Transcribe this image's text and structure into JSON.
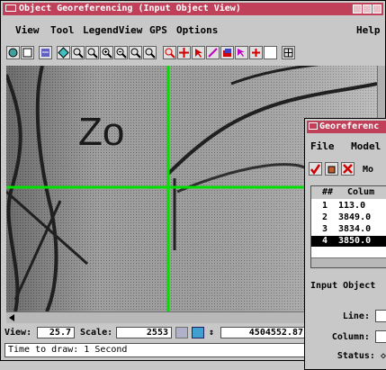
{
  "main_window": {
    "title": "Object Georeferencing (Input Object View)",
    "menu": [
      "View",
      "Tool",
      "LegendView",
      "GPS",
      "Options",
      "Help"
    ]
  },
  "map": {
    "overlay_text": "Zo",
    "crosshair_color": "#00e000"
  },
  "status": {
    "view_label": "View:",
    "view_value": "25.7",
    "scale_label": "Scale:",
    "scale_value": "2553",
    "coord_value": "4504552.87",
    "time_text": "Time to draw: 1 Second"
  },
  "georef_window": {
    "title": "Georeferenc",
    "menu": [
      "File",
      "Model"
    ],
    "toolbar_label": "Mo",
    "table": {
      "headers": [
        "##",
        "Colum"
      ],
      "rows": [
        {
          "num": "1",
          "col": "113.0"
        },
        {
          "num": "2",
          "col": "3849.0"
        },
        {
          "num": "3",
          "col": "3834.0"
        },
        {
          "num": "4",
          "col": "3850.0"
        }
      ],
      "selected_index": 3
    },
    "section_label": "Input Object",
    "fields": {
      "line": "Line:",
      "column": "Column:",
      "status": "Status:"
    }
  },
  "colors": {
    "title_bg": "#c0405a",
    "chrome": "#c8c8c8"
  }
}
